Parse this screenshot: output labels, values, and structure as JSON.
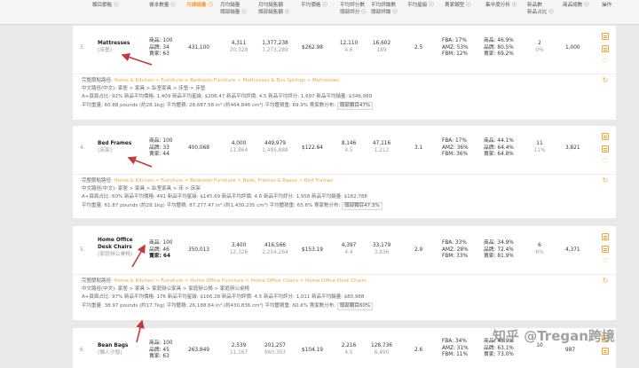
{
  "header": {
    "columns": [
      {
        "key": "col_num",
        "label": "#"
      },
      {
        "key": "col_node",
        "label": "類目節點 ⓘ"
      },
      {
        "key": "col_stock",
        "label": "樣本數量 ⓘ"
      },
      {
        "key": "col_monthly_sales",
        "label": "月總銷量 ⓘ"
      },
      {
        "key": "col_monthly_sales_sub",
        "label": "月均銷量\n頭部銷量 ⓘ"
      },
      {
        "key": "col_monthly_rev",
        "label": "月均銷售額\n頭部銷售額 ⓘ"
      },
      {
        "key": "col_avg_price",
        "label": "平均價格 ⓘ"
      },
      {
        "key": "col_avg_reviews",
        "label": "平均評分數\n頭部評分 ⓘ"
      },
      {
        "key": "col_review_count",
        "label": "平均評論數\n頭部評論 ⓘ"
      },
      {
        "key": "col_avg_rating",
        "label": "平均星級 ⓘ"
      },
      {
        "key": "col_seller_type",
        "label": "賣家類型 ⓘ"
      },
      {
        "key": "col_concentration",
        "label": "集中度分析 ⓘ"
      },
      {
        "key": "col_new_ratio",
        "label": "新品數\n新品占比 ⓘ"
      },
      {
        "key": "col_total",
        "label": "商品總數 ⓘ"
      },
      {
        "key": "col_ops",
        "label": "操作"
      }
    ]
  },
  "rows": [
    {
      "num": "3.",
      "name_line1": "Mattresses",
      "name_line2": "",
      "name_sub": "(床墊)",
      "counts": [
        "商品: 100",
        "品牌: 34",
        "賣家: 63"
      ],
      "monthly_sales": "431,100",
      "avg_sales": "4,311",
      "avg_sales_sub": "20,328",
      "avg_rev": "1,377,238",
      "avg_rev_sub": "7,273,289",
      "avg_price": "$262.98",
      "reviews": "12,110",
      "reviews_sub": "4.6",
      "review_count": "16,602",
      "review_count_sub": "189",
      "rating": "2.5",
      "seller": [
        "FBA: 17%",
        "AMZ: 53%",
        "FBM: 12%"
      ],
      "concentration": [
        "商品: 46.9%",
        "品牌: 80.5%",
        "賣家: 69.2%"
      ],
      "new_count": "2",
      "new_ratio": "0%",
      "total": "1,000",
      "detail": {
        "path_label": "完整節點路徑:",
        "path": "Home & Kitchen > Furniture > Bedroom Furniture > Mattresses & Box Springs > Mattresses",
        "cn_label": "中文路徑(中文):",
        "cn_path": "家居 > 家具 > 臥室家具 > 床墊 > 床墊",
        "stats1": "A+頁面占比: 92%    新品平均價格: 1,409    新品平均星級: $206.47    新品平均評價: 4.5    新品平均評分: 1,697    新品平均銷量: $346,980",
        "stats2": "平均重量: 60.88 pounds (約28.1kg)    平均體積: 28,687.58 in³ (約464,846 cm³)    平均體積重: 69.9%    賣家數分布:",
        "tag": "頭部類目47%"
      }
    },
    {
      "num": "4.",
      "name_line1": "Bed Frames",
      "name_line2": "",
      "name_sub": "(床架)",
      "counts": [
        "商品: 100",
        "品牌: 33",
        "賣家: 44"
      ],
      "monthly_sales": "400,068",
      "avg_sales": "4,000",
      "avg_sales_sub": "11,864",
      "avg_rev": "449,979",
      "avg_rev_sub": "1,495,888",
      "avg_price": "$122.64",
      "reviews": "8,146",
      "reviews_sub": "4.5",
      "review_count": "47,116",
      "review_count_sub": "1,212",
      "rating": "3.1",
      "seller": [
        "FBA: 17%",
        "AMZ: 36%",
        "FBM: 36%"
      ],
      "concentration": [
        "商品: 44.1%",
        "品牌: 64.4%",
        "賣家: 64.8%"
      ],
      "new_count": "11",
      "new_ratio": "11%",
      "total": "3,821",
      "detail": {
        "path_label": "完整節點路徑:",
        "path": "Home & Kitchen > Furniture > Bedroom Furniture > Beds, Frames & Bases > Bed Frames",
        "cn_label": "中文路徑(中文):",
        "cn_path": "家居 > 家具 > 臥室家具 > 床 > 床架",
        "stats1": "A+頁面占比: 60%    新品平均價格: 491    新品平均星級: $145.69    新品平均評價: 4.6    新品平均評分: 1,958    新品平均銷量: $182,788",
        "stats2": "平均重量: 61.87 pounds (約28.1kg)    平均體積: 87,277.47 in³ (約1,430,235 cm³)    平均體積重: 65.6%    賣家數分布:",
        "tag": "頭部類目47.3%"
      }
    },
    {
      "num": "5.",
      "name_line1": "Home Office",
      "name_line2": "Desk Chairs",
      "name_sub": "(家庭辦公桌椅)",
      "counts": [
        "商品: 100",
        "品牌: 46",
        "賣家: 64"
      ],
      "monthly_sales": "350,013",
      "avg_sales": "3,400",
      "avg_sales_sub": "12,326",
      "avg_rev": "416,566",
      "avg_rev_sub": "2,254,264",
      "avg_price": "$153.19",
      "reviews": "4,397",
      "reviews_sub": "4.4",
      "review_count": "33,179",
      "review_count_sub": "3,836",
      "rating": "2.9",
      "seller": [
        "FBA: 33%",
        "AMZ: 28%",
        "FBM: 33%"
      ],
      "concentration": [
        "商品: 34.9%",
        "品牌: 72.4%",
        "賣家: 81.9%"
      ],
      "new_count": "6",
      "new_ratio": "6%",
      "total": "4,371",
      "detail": {
        "path_label": "完整節點路徑:",
        "path": "Home & Kitchen > Furniture > Home Office Furniture > Home Office Chairs > Home Office Desk Chairs",
        "cn_label": "中文路徑(中文):",
        "cn_path": "家居 > 家具 > 家庭辦公家具 > 家庭辦公椅 > 家庭辦公桌椅",
        "stats1": "A+頁面占比: 97%    新品平均價格: 176    新品平均星級: $166.28    新品平均評價: 4.5    新品平均評分: 1,011    新品平均銷量: $80,988",
        "stats2": "平均重量: 38.97 pounds (約17.7kg)    平均體積: 26,188.64 in³ (約430,836 cm³)    平均體積重: 60.6%    賣家數分布:",
        "tag": "頭部類目60%"
      }
    },
    {
      "num": "6.",
      "name_line1": "Bean Bags",
      "name_line2": "",
      "name_sub": "(懶人沙發)",
      "counts": [
        "商品: 100",
        "品牌: 45",
        "賣家: 63"
      ],
      "monthly_sales": "263,849",
      "avg_sales": "2,539",
      "avg_sales_sub": "11,167",
      "avg_rev": "201,257",
      "avg_rev_sub": "860,303",
      "avg_price": "$104.19",
      "reviews": "2,216",
      "reviews_sub": "4.5",
      "review_count": "128,736",
      "review_count_sub": "6,490",
      "rating": "2.6",
      "seller": [
        "FBA: 34%",
        "AMZ: 31%",
        "FBM: 11%"
      ],
      "concentration": [
        "商品: 45.9%",
        "品牌: 63.1%",
        "賣家: 73.0%"
      ],
      "new_count": "10",
      "new_ratio": "",
      "total": "987",
      "detail": {}
    }
  ],
  "watermark": {
    "text": "知乎 @Tregan跨境"
  },
  "colors": {
    "accent": "#f2a43a",
    "arrow": "#c23a3a",
    "background": "#e9e9e9"
  }
}
